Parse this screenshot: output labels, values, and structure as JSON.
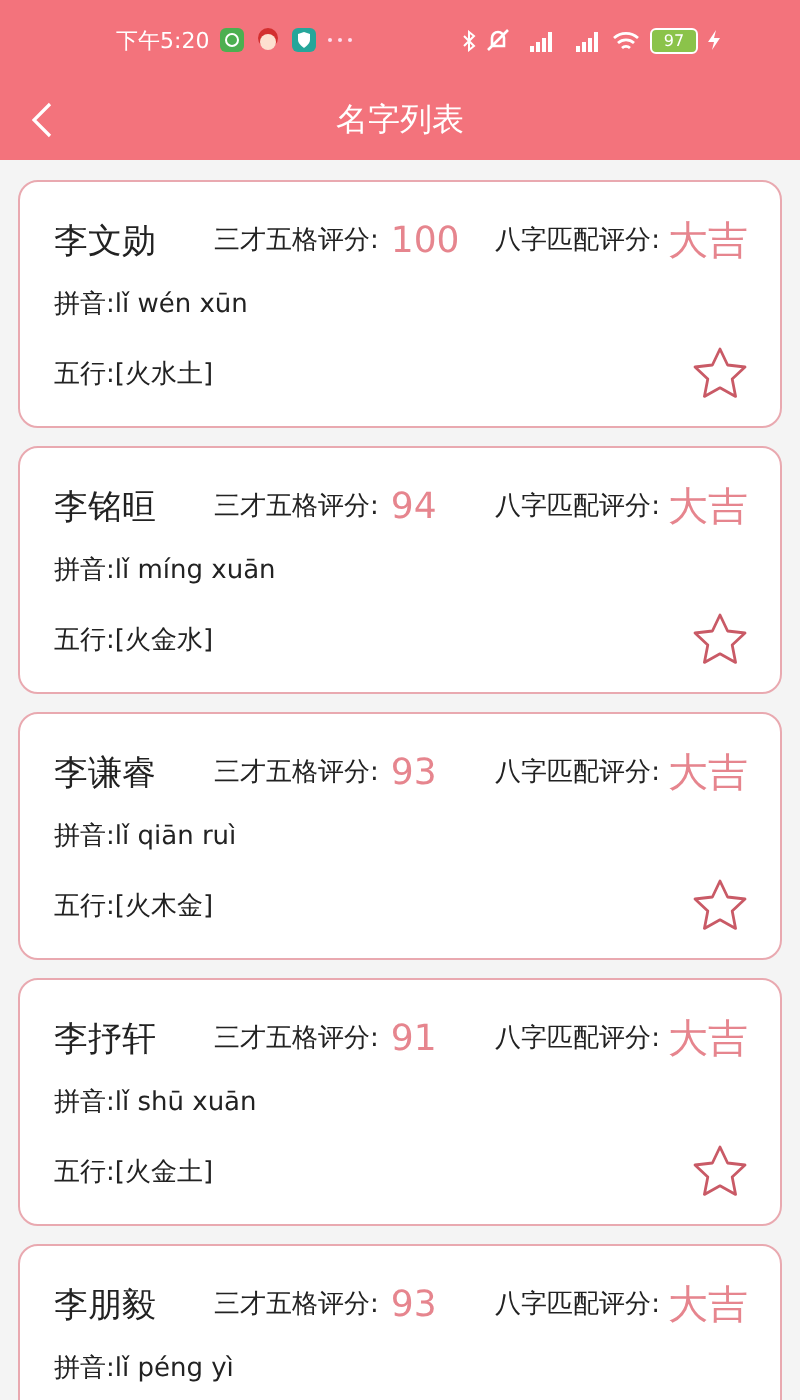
{
  "status_bar": {
    "time": "下午5:20",
    "battery": "97"
  },
  "header": {
    "title": "名字列表"
  },
  "names": [
    {
      "name": "李文勋",
      "score_label": "三才五格评分:",
      "score": "100",
      "bazi_label": "八字匹配评分:",
      "bazi": "大吉",
      "pinyin": "拼音:lǐ wén xūn",
      "wuxing": "五行:[火水土]",
      "favorited": false
    },
    {
      "name": "李铭晅",
      "score_label": "三才五格评分:",
      "score": "94",
      "bazi_label": "八字匹配评分:",
      "bazi": "大吉",
      "pinyin": "拼音:lǐ míng xuān",
      "wuxing": "五行:[火金水]",
      "favorited": false
    },
    {
      "name": "李谦睿",
      "score_label": "三才五格评分:",
      "score": "93",
      "bazi_label": "八字匹配评分:",
      "bazi": "大吉",
      "pinyin": "拼音:lǐ qiān ruì",
      "wuxing": "五行:[火木金]",
      "favorited": false
    },
    {
      "name": "李抒轩",
      "score_label": "三才五格评分:",
      "score": "91",
      "bazi_label": "八字匹配评分:",
      "bazi": "大吉",
      "pinyin": "拼音:lǐ shū xuān",
      "wuxing": "五行:[火金土]",
      "favorited": false
    },
    {
      "name": "李朋毅",
      "score_label": "三才五格评分:",
      "score": "93",
      "bazi_label": "八字匹配评分:",
      "bazi": "大吉",
      "pinyin": "拼音:lǐ péng yì"
    }
  ]
}
